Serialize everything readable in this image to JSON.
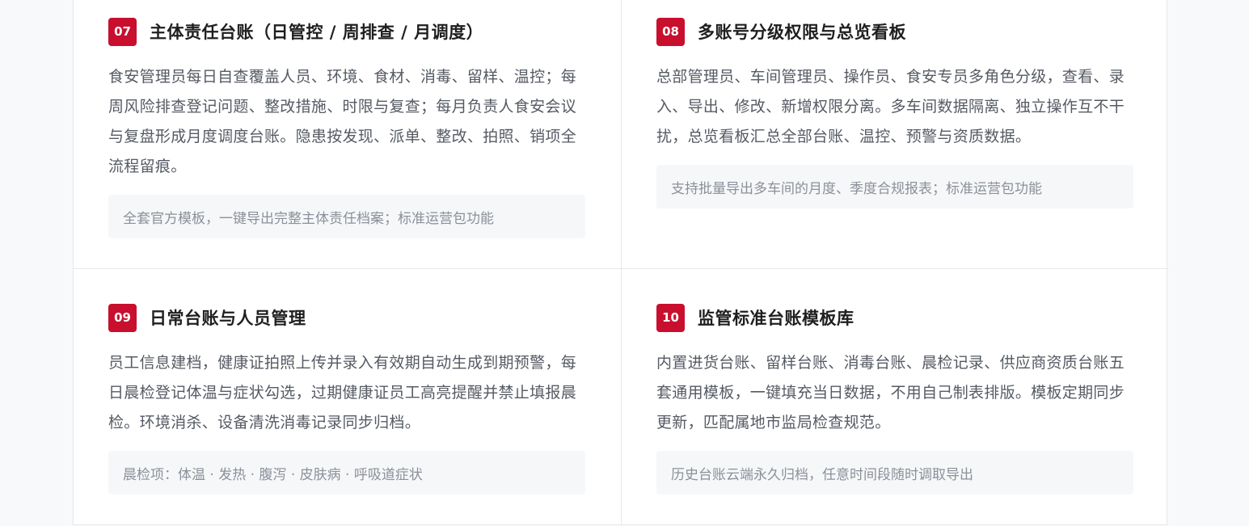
{
  "cards": [
    {
      "num": "07",
      "title": "主体责任台账（日管控 / 周排查 / 月调度）",
      "desc": "食安管理员每日自查覆盖人员、环境、食材、消毒、留样、温控；每周风险排查登记问题、整改措施、时限与复查；每月负责人食安会议与复盘形成月度调度台账。隐患按发现、派单、整改、拍照、销项全流程留痕。",
      "note": "全套官方模板，一键导出完整主体责任档案；标准运营包功能"
    },
    {
      "num": "08",
      "title": "多账号分级权限与总览看板",
      "desc": "总部管理员、车间管理员、操作员、食安专员多角色分级，查看、录入、导出、修改、新增权限分离。多车间数据隔离、独立操作互不干扰，总览看板汇总全部台账、温控、预警与资质数据。",
      "note": "支持批量导出多车间的月度、季度合规报表；标准运营包功能"
    },
    {
      "num": "09",
      "title": "日常台账与人员管理",
      "desc": "员工信息建档，健康证拍照上传并录入有效期自动生成到期预警，每日晨检登记体温与症状勾选，过期健康证员工高亮提醒并禁止填报晨检。环境消杀、设备清洗消毒记录同步归档。",
      "note": "晨检项：体温 · 发热 · 腹泻 · 皮肤病 · 呼吸道症状"
    },
    {
      "num": "10",
      "title": "监管标准台账模板库",
      "desc": "内置进货台账、留样台账、消毒台账、晨检记录、供应商资质台账五套通用模板，一键填充当日数据，不用自己制表排版。模板定期同步更新，匹配属地市监局检查规范。",
      "note": "历史台账云端永久归档，任意时间段随时调取导出"
    }
  ]
}
